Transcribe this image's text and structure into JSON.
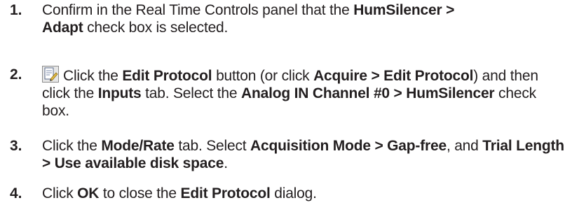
{
  "steps": [
    {
      "number": "1.",
      "parts": [
        "Confirm in the Real Time Controls panel that the ",
        "HumSilencer > Adapt",
        " check box is selected."
      ]
    },
    {
      "number": "2.",
      "icon": "edit-protocol-icon",
      "parts": [
        "Click the ",
        "Edit Protocol",
        " button (or click ",
        "Acquire > Edit Protocol",
        ") and then click the ",
        "Inputs",
        " tab. Select the ",
        "Analog IN Channel #0 > HumSilencer",
        " check box."
      ]
    },
    {
      "number": "3.",
      "parts": [
        "Click the ",
        "Mode/Rate",
        " tab. Select ",
        "Acquisition Mode > Gap-free",
        ", and ",
        "Trial Length > Use available disk space",
        "."
      ]
    },
    {
      "number": "4.",
      "parts": [
        "Click ",
        "OK",
        " to close the ",
        "Edit Protocol",
        " dialog."
      ]
    }
  ]
}
